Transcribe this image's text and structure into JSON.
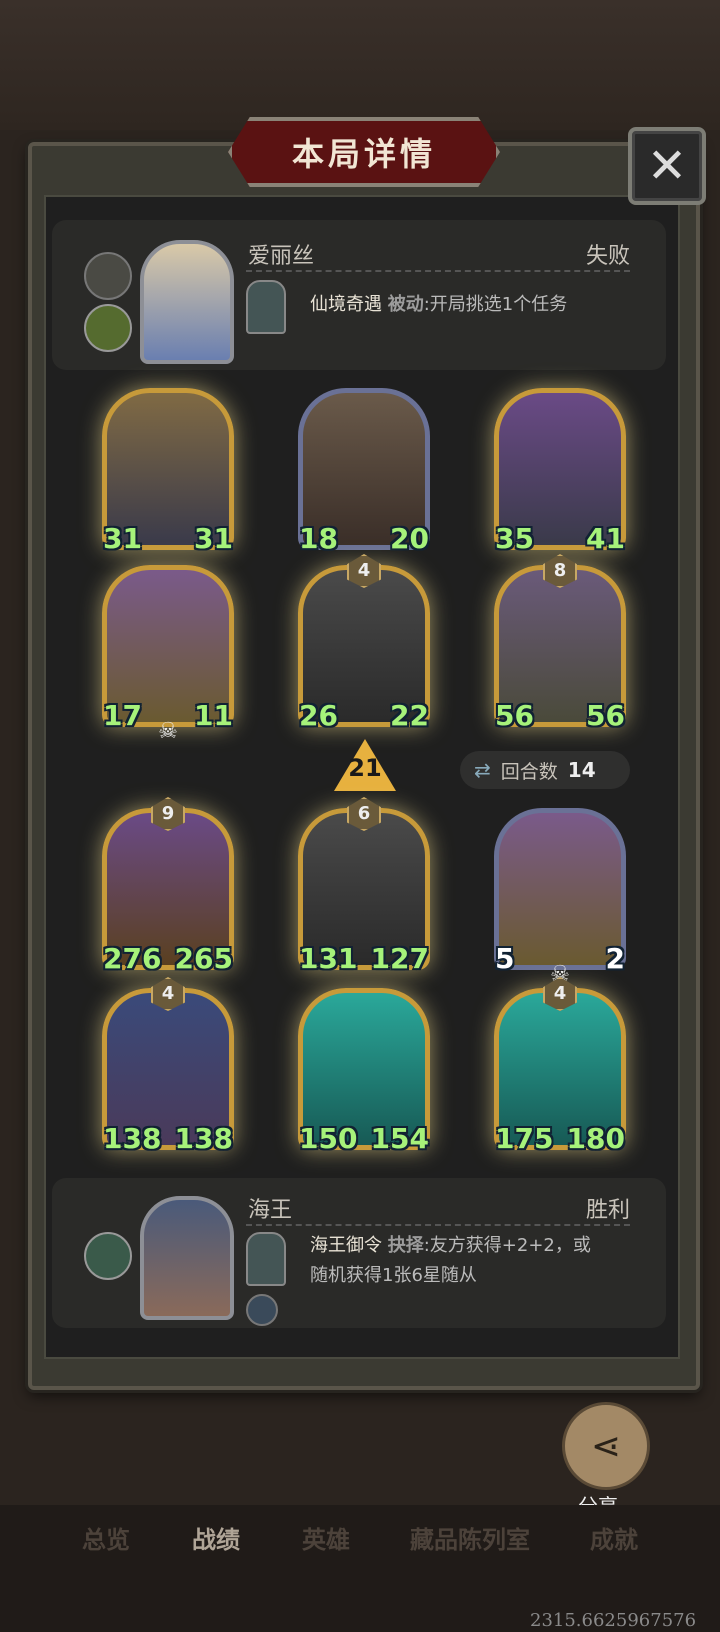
{
  "title": "本局详情",
  "top_player": {
    "name": "爱丽丝",
    "result": "失败",
    "skill_name": "仙境奇遇",
    "skill_type": "被动",
    "skill_desc": ":开局挑选1个任务"
  },
  "bottom_player": {
    "name": "海王",
    "result": "胜利",
    "skill_name": "海王御令",
    "skill_type": "抉择",
    "skill_desc_1": ":友方获得+2+2，或",
    "skill_desc_2": "随机获得1张6星随从"
  },
  "cards": [
    {
      "atk": "31",
      "hp": "31",
      "star": ""
    },
    {
      "atk": "18",
      "hp": "20",
      "star": ""
    },
    {
      "atk": "35",
      "hp": "41",
      "star": ""
    },
    {
      "atk": "17",
      "hp": "11",
      "star": ""
    },
    {
      "atk": "26",
      "hp": "22",
      "star": "4"
    },
    {
      "atk": "56",
      "hp": "56",
      "star": "8"
    },
    {
      "atk": "276",
      "hp": "265",
      "star": "9"
    },
    {
      "atk": "131",
      "hp": "127",
      "star": "6"
    },
    {
      "atk": "5",
      "hp": "2",
      "star": ""
    },
    {
      "atk": "138",
      "hp": "138",
      "star": "4"
    },
    {
      "atk": "150",
      "hp": "154",
      "star": ""
    },
    {
      "atk": "175",
      "hp": "180",
      "star": "4"
    }
  ],
  "round_label": "回合数",
  "round_value": "14",
  "damage_value": "21",
  "share_label": "分享",
  "tabs": [
    "总览",
    "战绩",
    "英雄",
    "藏品陈列室",
    "成就"
  ],
  "active_tab": "战绩",
  "build_id": "2315.6625967576"
}
